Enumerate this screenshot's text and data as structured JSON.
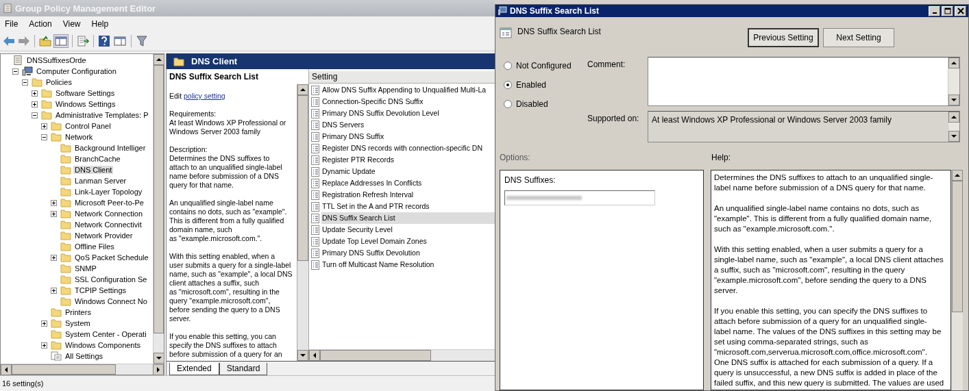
{
  "editor": {
    "title": "Group Policy Management Editor",
    "menu": [
      "File",
      "Action",
      "View",
      "Help"
    ],
    "tree": {
      "items": [
        {
          "label": "DNSSuffixesOrde",
          "kind": "document",
          "selected": false,
          "children": [
            {
              "label": "Computer Configuration",
              "kind": "computer",
              "selected": false,
              "expanded": true,
              "children": [
                {
                  "label": "Policies",
                  "kind": "folder",
                  "selected": false,
                  "expanded": true,
                  "children": [
                    {
                      "label": "Software Settings",
                      "kind": "folder",
                      "selected": false,
                      "expanded": false
                    },
                    {
                      "label": "Windows Settings",
                      "kind": "folder",
                      "selected": false,
                      "expanded": false
                    },
                    {
                      "label": "Administrative Templates: P",
                      "kind": "folder",
                      "selected": false,
                      "expanded": true,
                      "children": [
                        {
                          "label": "Control Panel",
                          "kind": "folder",
                          "selected": false,
                          "expanded": false
                        },
                        {
                          "label": "Network",
                          "kind": "folder",
                          "selected": false,
                          "expanded": true,
                          "children": [
                            {
                              "label": "Background Intelliger",
                              "kind": "folder",
                              "selected": false
                            },
                            {
                              "label": "BranchCache",
                              "kind": "folder",
                              "selected": false
                            },
                            {
                              "label": "DNS Client",
                              "kind": "folder",
                              "selected": true
                            },
                            {
                              "label": "Lanman Server",
                              "kind": "folder",
                              "selected": false
                            },
                            {
                              "label": "Link-Layer Topology",
                              "kind": "folder",
                              "selected": false
                            },
                            {
                              "label": "Microsoft Peer-to-Pe",
                              "kind": "folder",
                              "selected": false,
                              "expanded": false
                            },
                            {
                              "label": "Network Connection",
                              "kind": "folder",
                              "selected": false,
                              "expanded": false
                            },
                            {
                              "label": "Network Connectivit",
                              "kind": "folder",
                              "selected": false
                            },
                            {
                              "label": "Network Provider",
                              "kind": "folder",
                              "selected": false
                            },
                            {
                              "label": "Offline Files",
                              "kind": "folder",
                              "selected": false
                            },
                            {
                              "label": "QoS Packet Schedule",
                              "kind": "folder",
                              "selected": false,
                              "expanded": false
                            },
                            {
                              "label": "SNMP",
                              "kind": "folder",
                              "selected": false
                            },
                            {
                              "label": "SSL Configuration Se",
                              "kind": "folder",
                              "selected": false
                            },
                            {
                              "label": "TCPIP Settings",
                              "kind": "folder",
                              "selected": false,
                              "expanded": false
                            },
                            {
                              "label": "Windows Connect No",
                              "kind": "folder",
                              "selected": false
                            }
                          ]
                        },
                        {
                          "label": "Printers",
                          "kind": "folder",
                          "selected": false
                        },
                        {
                          "label": "System",
                          "kind": "folder",
                          "selected": false,
                          "expanded": false
                        },
                        {
                          "label": "System Center - Operati",
                          "kind": "folder",
                          "selected": false
                        },
                        {
                          "label": "Windows Components",
                          "kind": "folder",
                          "selected": false,
                          "expanded": false
                        },
                        {
                          "label": "All Settings",
                          "kind": "settings",
                          "selected": false
                        }
                      ]
                    }
                  ]
                }
              ]
            }
          ]
        }
      ]
    },
    "pane_title": "DNS Client",
    "description": {
      "title": "DNS Suffix Search List",
      "edit_prefix": "Edit",
      "edit_link": "policy setting",
      "paragraphs": [
        "Requirements:\nAt least Windows XP Professional or\nWindows Server 2003 family",
        "Description:\nDetermines the DNS suffixes to\nattach to an unqualified single-label\nname before submission of a DNS\nquery for that name.",
        "An unqualified single-label name\ncontains no dots, such as \"example\".\nThis is different from a fully qualified\ndomain name, such\nas \"example.microsoft.com.\".",
        "With this setting enabled, when a\nuser submits a query for a single-label\nname, such as \"example\", a local DNS\nclient attaches a suffix, such\nas \"microsoft.com\", resulting in the\nquery \"example.microsoft.com\",\nbefore sending the query to a DNS\nserver.",
        "If you enable this setting, you can\nspecify the DNS suffixes to attach\nbefore submission of a query for an"
      ]
    },
    "list": {
      "column": "Setting",
      "rows": [
        {
          "label": "Allow DNS Suffix Appending to Unqualified Multi-La",
          "selected": false
        },
        {
          "label": "Connection-Specific DNS Suffix",
          "selected": false
        },
        {
          "label": "Primary DNS Suffix Devolution Level",
          "selected": false
        },
        {
          "label": "DNS Servers",
          "selected": false
        },
        {
          "label": "Primary DNS Suffix",
          "selected": false
        },
        {
          "label": "Register DNS records with connection-specific DN",
          "selected": false
        },
        {
          "label": "Register PTR Records",
          "selected": false
        },
        {
          "label": "Dynamic Update",
          "selected": false
        },
        {
          "label": "Replace Addresses In Conflicts",
          "selected": false
        },
        {
          "label": "Registration Refresh Interval",
          "selected": false
        },
        {
          "label": "TTL Set in the A and PTR records",
          "selected": false
        },
        {
          "label": "DNS Suffix Search List",
          "selected": true
        },
        {
          "label": "Update Security Level",
          "selected": false
        },
        {
          "label": "Update Top Level Domain Zones",
          "selected": false
        },
        {
          "label": "Primary DNS Suffix Devolution",
          "selected": false
        },
        {
          "label": "Turn off Multicast Name Resolution",
          "selected": false
        }
      ]
    },
    "tabs": [
      {
        "label": "Extended",
        "selected": true
      },
      {
        "label": "Standard",
        "selected": false
      }
    ],
    "status_bar": "16 setting(s)"
  },
  "dialog": {
    "title": "DNS Suffix Search List",
    "setting_name": "DNS Suffix Search List",
    "buttons": [
      {
        "label": "Previous Setting",
        "default": true
      },
      {
        "label": "Next Setting",
        "default": false
      }
    ],
    "radios": [
      {
        "label": "Not Configured",
        "selected": false
      },
      {
        "label": "Enabled",
        "selected": true
      },
      {
        "label": "Disabled",
        "selected": false
      }
    ],
    "comment_label": "Comment:",
    "supported_label": "Supported on:",
    "supported_value": "At least Windows XP Professional or Windows Server 2003 family",
    "options_label": "Options:",
    "help_label": "Help:",
    "option_field_label": "DNS Suffixes:",
    "help": [
      "Determines the DNS suffixes to attach to an unqualified single-\nlabel name before submission of a DNS query for that name.",
      "An unqualified single-label name contains no dots, such as\n\"example\". This is different from a fully qualified domain name,\nsuch as \"example.microsoft.com.\".",
      "With this setting enabled, when a user submits a query for a\nsingle-label name, such as \"example\", a local DNS client attaches\na suffix, such as \"microsoft.com\", resulting in the query\n\"example.microsoft.com\", before sending the query to a DNS\nserver.",
      "If you enable this setting, you can specify the DNS suffixes to\nattach before submission of a query for an unqualified single-\nlabel name. The values of the DNS suffixes in this setting may be\nset using comma-separated strings, such as\n\"microsoft.com,serverua.microsoft.com,office.microsoft.com\".\nOne DNS suffix is attached for each submission of a query. If a\nquery is unsuccessful, a new DNS suffix is added in place of the\nfailed suffix, and this new query is submitted. The values are used"
    ]
  }
}
